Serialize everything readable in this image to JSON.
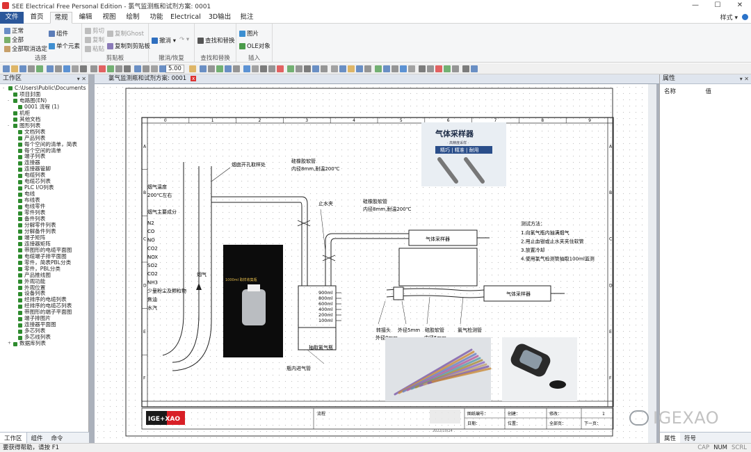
{
  "titlebar": {
    "title": "SEE Electrical Free Personal Edition - 氯气监测瓶和试剂方案: 0001",
    "win": [
      "—",
      "☐",
      "✕"
    ]
  },
  "tabs": [
    "文件",
    "首页",
    "常规",
    "编辑",
    "视图",
    "绘制",
    "功能",
    "Electrical",
    "3D输出",
    "批注"
  ],
  "tabs_right": "样式 ▾",
  "ribbon": {
    "groups": [
      {
        "label": "选择",
        "items": [
          "正常",
          "全部",
          "全部取消选定",
          "组件",
          "单个元素"
        ]
      },
      {
        "label": "剪贴板",
        "items": [
          "剪切",
          "复制",
          "粘贴",
          "复制Ghost",
          "复制到剪贴板"
        ]
      },
      {
        "label": "撤消/恢复",
        "items": [
          "撤消 ▾",
          "↷ ▾"
        ]
      },
      {
        "label": "查找和替换",
        "items": [
          "查找和替换"
        ]
      },
      {
        "label": "插入",
        "items": [
          "图片",
          "OLE对象"
        ]
      }
    ]
  },
  "toolbar": {
    "zoom": "5.00"
  },
  "workspace": {
    "title": "工作区",
    "tree": [
      {
        "t": "C:\\Users\\Public\\Documents",
        "lvl": 0,
        "exp": "-"
      },
      {
        "t": "项目封面",
        "lvl": 1,
        "exp": ""
      },
      {
        "t": "电路图(EN)",
        "lvl": 1,
        "exp": "-"
      },
      {
        "t": "0001  流程 (1)",
        "lvl": 2,
        "exp": ""
      },
      {
        "t": "机柜",
        "lvl": 1,
        "exp": ""
      },
      {
        "t": "其他文档",
        "lvl": 1,
        "exp": ""
      },
      {
        "t": "图形列表",
        "lvl": 1,
        "exp": "-"
      },
      {
        "t": "文档列表",
        "lvl": 2,
        "exp": ""
      },
      {
        "t": "产品列表",
        "lvl": 2,
        "exp": ""
      },
      {
        "t": "每个空间的清单，简表",
        "lvl": 2,
        "exp": ""
      },
      {
        "t": "每个空间的清单",
        "lvl": 2,
        "exp": ""
      },
      {
        "t": "端子列表",
        "lvl": 2,
        "exp": ""
      },
      {
        "t": "连接器",
        "lvl": 2,
        "exp": ""
      },
      {
        "t": "连接器管脚",
        "lvl": 2,
        "exp": ""
      },
      {
        "t": "电缆列表",
        "lvl": 2,
        "exp": ""
      },
      {
        "t": "电缆芯列表",
        "lvl": 2,
        "exp": ""
      },
      {
        "t": "PLC I/O列表",
        "lvl": 2,
        "exp": ""
      },
      {
        "t": "电线",
        "lvl": 2,
        "exp": ""
      },
      {
        "t": "布线表",
        "lvl": 2,
        "exp": ""
      },
      {
        "t": "电线零件",
        "lvl": 2,
        "exp": ""
      },
      {
        "t": "零件列表",
        "lvl": 2,
        "exp": ""
      },
      {
        "t": "备件列表",
        "lvl": 2,
        "exp": ""
      },
      {
        "t": "分解零件列表",
        "lvl": 2,
        "exp": ""
      },
      {
        "t": "分解备件列表",
        "lvl": 2,
        "exp": ""
      },
      {
        "t": "端子矩阵",
        "lvl": 2,
        "exp": ""
      },
      {
        "t": "连接器矩阵",
        "lvl": 2,
        "exp": ""
      },
      {
        "t": "带图形的电缆平面图",
        "lvl": 2,
        "exp": ""
      },
      {
        "t": "电缆端子排平面图",
        "lvl": 2,
        "exp": ""
      },
      {
        "t": "零件，简表PBL分类",
        "lvl": 2,
        "exp": ""
      },
      {
        "t": "零件，PBL分类",
        "lvl": 2,
        "exp": ""
      },
      {
        "t": "产品推线图",
        "lvl": 2,
        "exp": ""
      },
      {
        "t": "外观功能",
        "lvl": 2,
        "exp": ""
      },
      {
        "t": "外观位置",
        "lvl": 2,
        "exp": ""
      },
      {
        "t": "设备列表",
        "lvl": 2,
        "exp": ""
      },
      {
        "t": "经排序的电缆列表",
        "lvl": 2,
        "exp": ""
      },
      {
        "t": "经排序的电缆芯列表",
        "lvl": 2,
        "exp": ""
      },
      {
        "t": "带图形的端子平面图",
        "lvl": 2,
        "exp": ""
      },
      {
        "t": "端子排图片",
        "lvl": 2,
        "exp": ""
      },
      {
        "t": "连接器平面图",
        "lvl": 2,
        "exp": ""
      },
      {
        "t": "多芯列表",
        "lvl": 2,
        "exp": ""
      },
      {
        "t": "多芯线列表",
        "lvl": 2,
        "exp": ""
      },
      {
        "t": "数据库列表",
        "lvl": 1,
        "exp": "+"
      }
    ],
    "tabs": [
      "工作区",
      "组件",
      "命令"
    ]
  },
  "document": {
    "tab": "氯气监测瓶和试剂方案: 0001",
    "ruler_cols": [
      "0",
      "1",
      "2",
      "3",
      "4",
      "5",
      "6",
      "7",
      "8",
      "9"
    ],
    "ruler_rows": [
      "A",
      "B",
      "C",
      "D",
      "E",
      "F"
    ],
    "labels": {
      "flue_hole": "烟囱开孔取样处",
      "silicone1": "硅橡胶软管",
      "silicone1_spec": "内径8mm,耐温200℃",
      "clamp": "止水夹",
      "silicone2": "硅橡胶软管",
      "silicone2_spec": "内径8mm,耐温200℃",
      "flue_temp": "烟气温度",
      "flue_temp_val": "200℃左右",
      "flue_comp": "烟气主要成分",
      "components": [
        "N2",
        "CO",
        "NO",
        "CO2",
        "NOX",
        "SO2",
        "CO2",
        "NH3",
        "少量粉尘及颗粒物",
        "焦油",
        "水汽"
      ],
      "flue": "烟气",
      "volumes": [
        "900ml",
        "800ml",
        "600ml",
        "400ml",
        "200ml",
        "100ml"
      ],
      "bottle": "抽取氯气瓶",
      "inlet": "瓶内进气管",
      "sampler1": "气体采样器",
      "sampler2": "气体采样器",
      "method_title": "测试方法：",
      "methods": [
        "1.向氯气瓶内抽满烟气",
        "2.用止血钳或止水夹夹住软管",
        "3.放置冷却",
        "4.使用氯气检测管抽取100ml监测"
      ],
      "connector": "转接头",
      "connector_spec": "外径8mm",
      "outer": "外径5mm",
      "silicone3": "硅胶软管",
      "silicone3_spec": "内径5mm",
      "tube": "氯气检测管",
      "photo_title": "气体采样器",
      "photo_sub": "· 高精度采样 ·",
      "photo_tags": "精巧 | 精准 | 耐用",
      "phone_title": "1000ml 取样收集瓶"
    },
    "titleblock": {
      "logo": "IGE+XAO",
      "desc": "流程",
      "fields": [
        "图纸编号：",
        "创建：",
        "修改：",
        "2022/10/14",
        "日期：",
        "位置：",
        "全部页：",
        "1",
        "下一页："
      ]
    }
  },
  "properties": {
    "title": "属性",
    "cols": [
      "名称",
      "值"
    ],
    "tabs": [
      "属性",
      "符号"
    ]
  },
  "status": {
    "left": "要获得帮助，请按 F1",
    "right": [
      "CAP",
      "NUM",
      "SCRL"
    ]
  },
  "watermark": "IGEXAO"
}
